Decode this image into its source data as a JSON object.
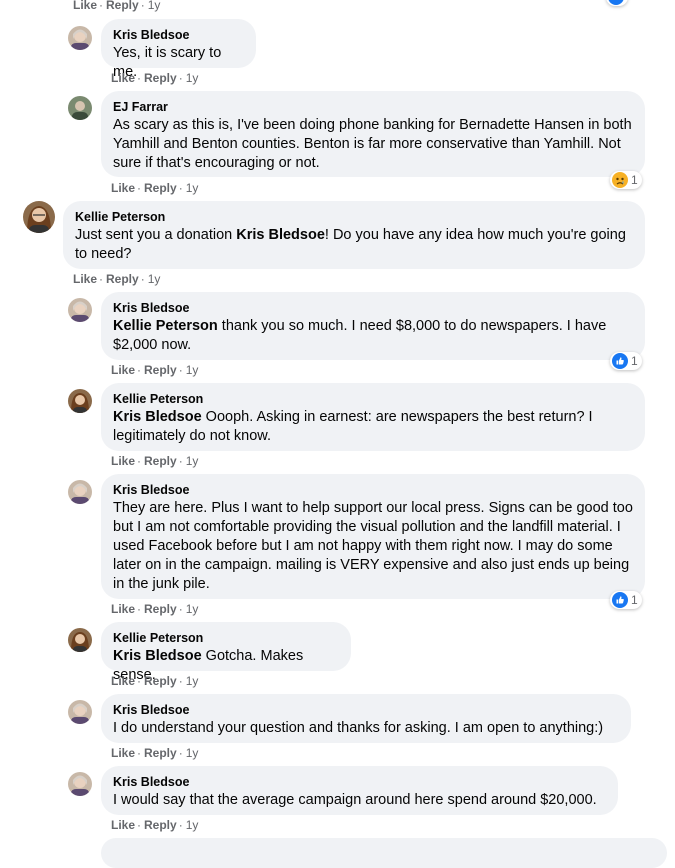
{
  "labels": {
    "like": "Like",
    "reply": "Reply",
    "sep": "·",
    "time": "1y"
  },
  "comments": [
    {
      "author": "Kris Bledsoe",
      "parts": [
        {
          "t": "Yes, it is scary to me.",
          "b": false
        }
      ]
    },
    {
      "author": "EJ Farrar",
      "parts": [
        {
          "t": "As scary as this is, I've been doing phone banking for Bernadette Hansen in both Yamhill and Benton counties. Benton is far more conservative than Yamhill. Not sure if that's encouraging or not.",
          "b": false
        }
      ],
      "reaction_count": "1"
    },
    {
      "author": "Kellie Peterson",
      "parts": [
        {
          "t": "Just sent you a donation ",
          "b": false
        },
        {
          "t": "Kris Bledsoe",
          "b": true
        },
        {
          "t": "! Do you have any idea how much you're going to need?",
          "b": false
        }
      ]
    },
    {
      "author": "Kris Bledsoe",
      "parts": [
        {
          "t": "Kellie Peterson",
          "b": true
        },
        {
          "t": " thank you so much. I need $8,000 to do newspapers. I have $2,000 now.",
          "b": false
        }
      ],
      "reaction_count": "1"
    },
    {
      "author": "Kellie Peterson",
      "parts": [
        {
          "t": "Kris Bledsoe",
          "b": true
        },
        {
          "t": " Oooph. Asking in earnest: are newspapers the best return? I legitimately do not know.",
          "b": false
        }
      ]
    },
    {
      "author": "Kris Bledsoe",
      "parts": [
        {
          "t": "They are here. Plus I want to help support our local press. Signs can be good too but I am not comfortable providing the visual pollution and the landfill material. I used Facebook before but I am not happy with them right now. I may do some later on in the campaign. mailing is VERY expensive and also just ends up being in the junk pile.",
          "b": false
        }
      ],
      "reaction_count": "1"
    },
    {
      "author": "Kellie Peterson",
      "parts": [
        {
          "t": "Kris Bledsoe",
          "b": true
        },
        {
          "t": " Gotcha. Makes sense.",
          "b": false
        }
      ]
    },
    {
      "author": "Kris Bledsoe",
      "parts": [
        {
          "t": "I do understand your question and thanks for asking. I am open to anything:)",
          "b": false
        }
      ]
    },
    {
      "author": "Kris Bledsoe",
      "parts": [
        {
          "t": "I would say that the average campaign around here spend around $20,000.",
          "b": false
        }
      ]
    }
  ],
  "colors": {
    "bubble": "#f0f2f5",
    "meta": "#65676b",
    "like_blue": "#1877f2",
    "sad_yellow": "#f7b125"
  }
}
